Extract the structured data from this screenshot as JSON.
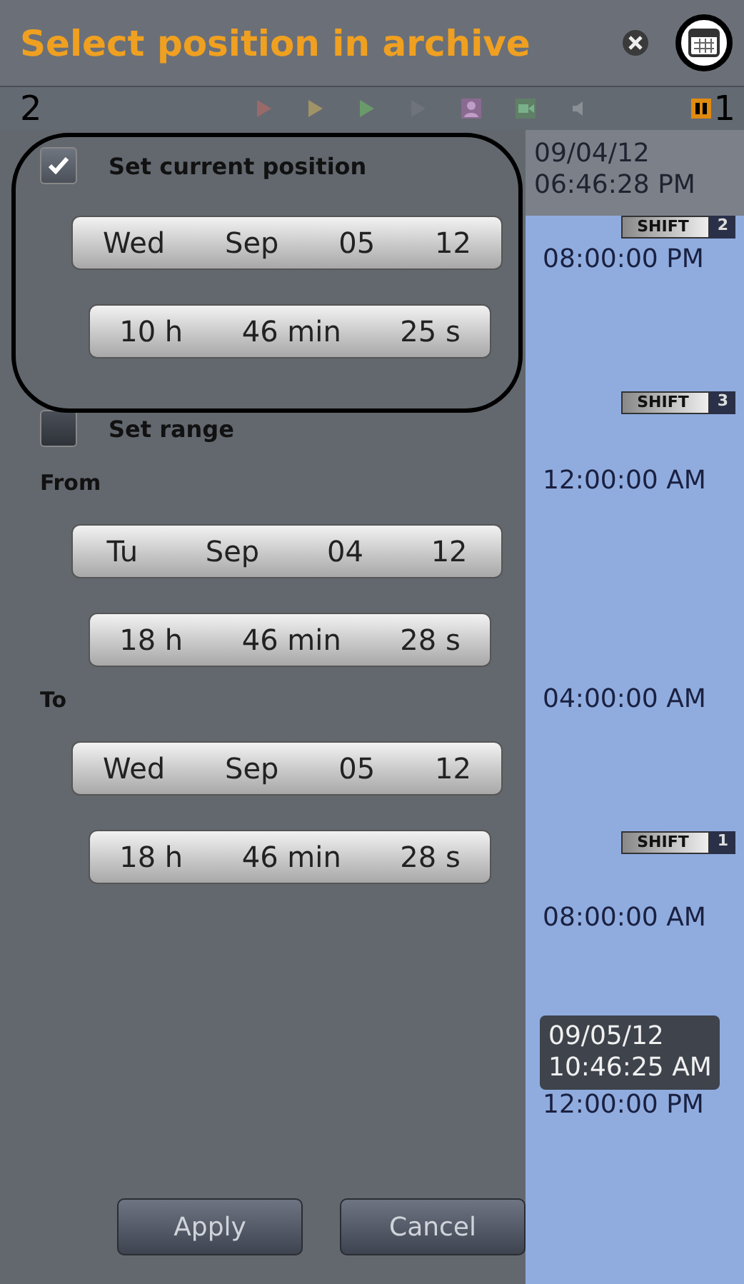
{
  "dialog": {
    "title": "Select position in archive",
    "toolbar": {
      "left_number": "2",
      "right_number": "1"
    },
    "current": {
      "label": "Set current position",
      "checked": true,
      "date": [
        "Wed",
        "Sep",
        "05",
        "12"
      ],
      "time": [
        "10 h",
        "46 min",
        "25 s"
      ]
    },
    "range": {
      "label": "Set range",
      "checked": false,
      "from": {
        "label": "From",
        "date": [
          "Tu",
          "Sep",
          "04",
          "12"
        ],
        "time": [
          "18 h",
          "46 min",
          "28 s"
        ]
      },
      "to": {
        "label": "To",
        "date": [
          "Wed",
          "Sep",
          "05",
          "12"
        ],
        "time": [
          "18 h",
          "46 min",
          "28 s"
        ]
      }
    },
    "buttons": [
      "Apply",
      "Cancel"
    ]
  },
  "timeline": [
    {
      "kind": "stamp",
      "lines": [
        "09/04/12",
        "06:46:28 PM"
      ]
    },
    {
      "kind": "shift",
      "label": "SHIFT",
      "number": "2"
    },
    {
      "kind": "time",
      "label": "08:00:00 PM"
    },
    {
      "kind": "shift",
      "label": "SHIFT",
      "number": "3"
    },
    {
      "kind": "time",
      "label": "12:00:00 AM"
    },
    {
      "kind": "time",
      "label": "04:00:00 AM"
    },
    {
      "kind": "shift",
      "label": "SHIFT",
      "number": "1"
    },
    {
      "kind": "time",
      "label": "08:00:00 AM"
    },
    {
      "kind": "tooltip",
      "lines": [
        "09/05/12",
        "10:46:25 AM"
      ]
    },
    {
      "kind": "time",
      "label": "12:00:00 PM"
    }
  ]
}
